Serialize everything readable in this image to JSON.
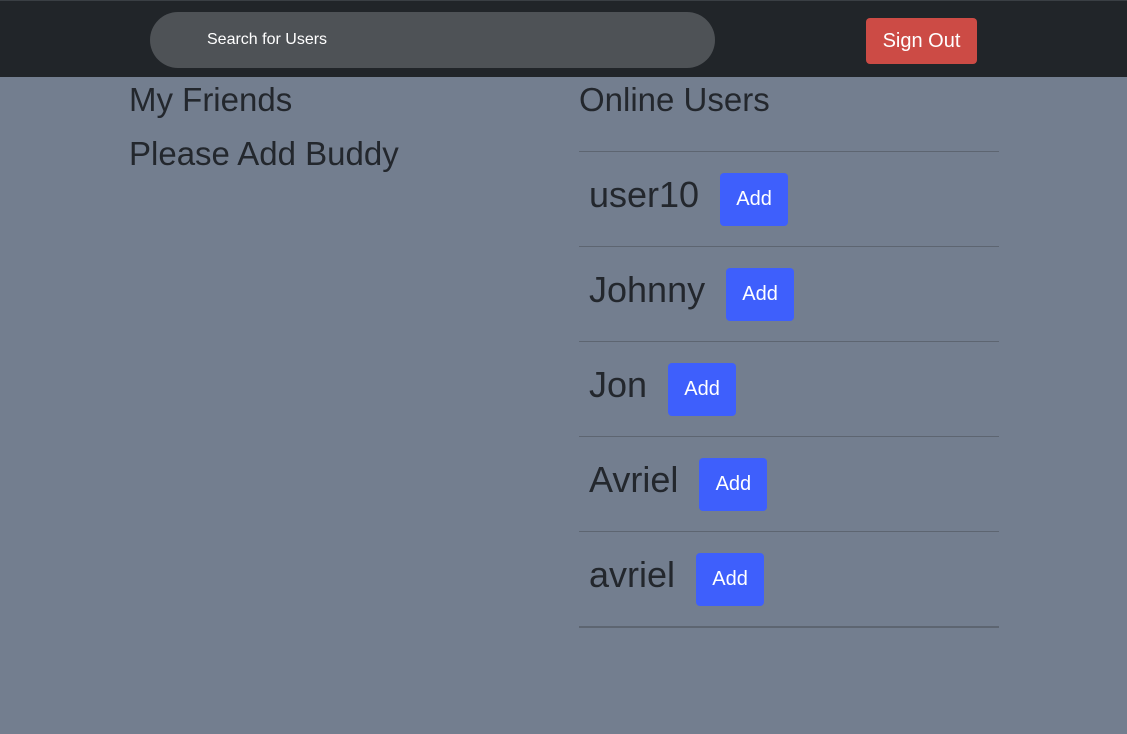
{
  "header": {
    "search_placeholder": "Search for Users",
    "signout_label": "Sign Out"
  },
  "friends": {
    "title": "My Friends",
    "empty_message": "Please Add Buddy"
  },
  "online": {
    "title": "Online Users",
    "add_label": "Add",
    "users": [
      {
        "name": "user10"
      },
      {
        "name": "Johnny"
      },
      {
        "name": "Jon"
      },
      {
        "name": "Avriel"
      },
      {
        "name": "avriel"
      }
    ]
  },
  "colors": {
    "background": "#737e8f",
    "navbar": "#212529",
    "search_bg": "#4e5256",
    "signout": "#cc4b45",
    "add_button": "#3e5ffc",
    "text_dark": "#23272d"
  }
}
